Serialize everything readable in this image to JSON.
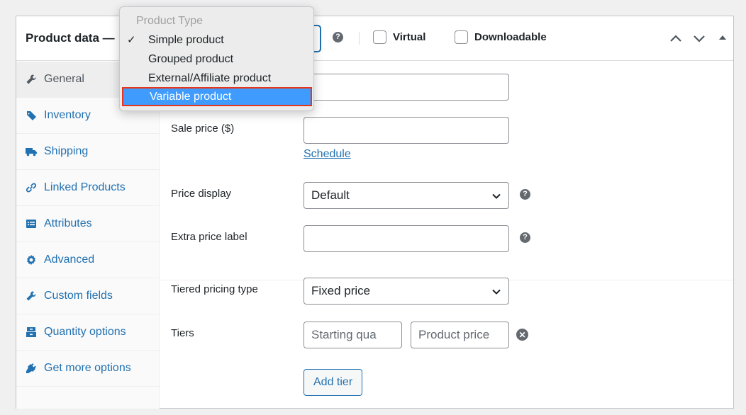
{
  "panel": {
    "title": "Product data —",
    "virtual_label": "Virtual",
    "downloadable_label": "Downloadable",
    "help_glyph": "?"
  },
  "product_type_dropdown": {
    "group_label": "Product Type",
    "options": [
      {
        "label": "Simple product",
        "checked": true
      },
      {
        "label": "Grouped product",
        "checked": false
      },
      {
        "label": "External/Affiliate product",
        "checked": false
      },
      {
        "label": "Variable product",
        "highlighted": true
      }
    ],
    "check_glyph": "✓"
  },
  "tabs": [
    {
      "label": "General",
      "icon": "wrench-icon",
      "active": true
    },
    {
      "label": "Inventory",
      "icon": "tag-icon"
    },
    {
      "label": "Shipping",
      "icon": "truck-icon"
    },
    {
      "label": "Linked Products",
      "icon": "link-icon"
    },
    {
      "label": "Attributes",
      "icon": "list-icon"
    },
    {
      "label": "Advanced",
      "icon": "gear-icon"
    },
    {
      "label": "Custom fields",
      "icon": "wrench-icon"
    },
    {
      "label": "Quantity options",
      "icon": "box-icon"
    },
    {
      "label": "Get more options",
      "icon": "plug-icon"
    }
  ],
  "general": {
    "regular_price_value": "",
    "sale_price_label": "Sale price ($)",
    "sale_price_value": "",
    "schedule_link": "Schedule",
    "price_display_label": "Price display",
    "price_display_value": "Default",
    "extra_price_label": "Extra price label",
    "extra_price_value": "",
    "tiered_pricing_type_label": "Tiered pricing type",
    "tiered_pricing_type_value": "Fixed price",
    "tiers_label": "Tiers",
    "starting_qty_placeholder": "Starting qua",
    "product_price_placeholder": "Product price",
    "remove_glyph": "✕",
    "add_tier_button": "Add tier"
  },
  "colors": {
    "link": "#2271b1",
    "highlight": "#3f9cfe",
    "highlight_border": "#e8361e"
  }
}
